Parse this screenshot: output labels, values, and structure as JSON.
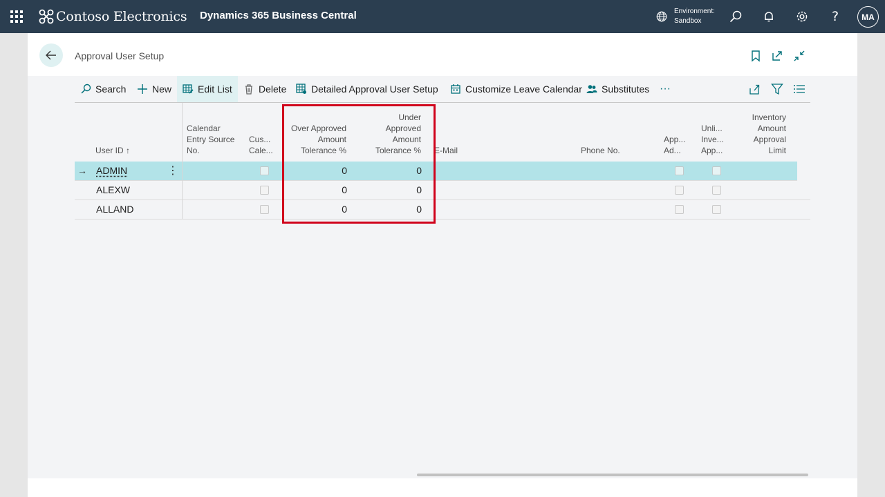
{
  "app": {
    "company": "Contoso Electronics",
    "product": "Dynamics 365 Business Central",
    "environment_label": "Environment:",
    "environment_value": "Sandbox",
    "user_initials": "MA",
    "help_glyph": "?"
  },
  "page": {
    "title": "Approval User Setup"
  },
  "actions": {
    "search": "Search",
    "new": "New",
    "edit_list": "Edit List",
    "delete": "Delete",
    "detailed": "Detailed Approval User Setup",
    "customize_calendar": "Customize Leave Calendar",
    "substitutes": "Substitutes",
    "more": "···"
  },
  "columns": {
    "user_id": "User ID ↑",
    "calendar_entry": [
      "Calendar",
      "Entry Source",
      "No."
    ],
    "customized_calendar": [
      "Cus...",
      "Cale..."
    ],
    "over_approved": [
      "Over Approved",
      "Amount",
      "Tolerance %"
    ],
    "under_approved": [
      "Under",
      "Approved",
      "Amount",
      "Tolerance %"
    ],
    "email": "E-Mail",
    "phone": "Phone No.",
    "approval_admin": [
      "App...",
      "Ad..."
    ],
    "unlimited_inventory": [
      "Unli...",
      "Inve...",
      "App..."
    ],
    "inventory_limit": [
      "Inventory",
      "Amount",
      "Approval",
      "Limit"
    ]
  },
  "rows": [
    {
      "user_id": "ADMIN",
      "over_tolerance": "0",
      "under_tolerance": "0"
    },
    {
      "user_id": "ALEXW",
      "over_tolerance": "0",
      "under_tolerance": "0"
    },
    {
      "user_id": "ALLAND",
      "over_tolerance": "0",
      "under_tolerance": "0"
    }
  ],
  "row_indicators": {
    "arrow": "→",
    "more": "⋮"
  },
  "colors": {
    "topbar": "#2b3e50",
    "accent": "#008489",
    "selected_row": "#b2e3e8",
    "highlight_box": "#d0021b"
  }
}
